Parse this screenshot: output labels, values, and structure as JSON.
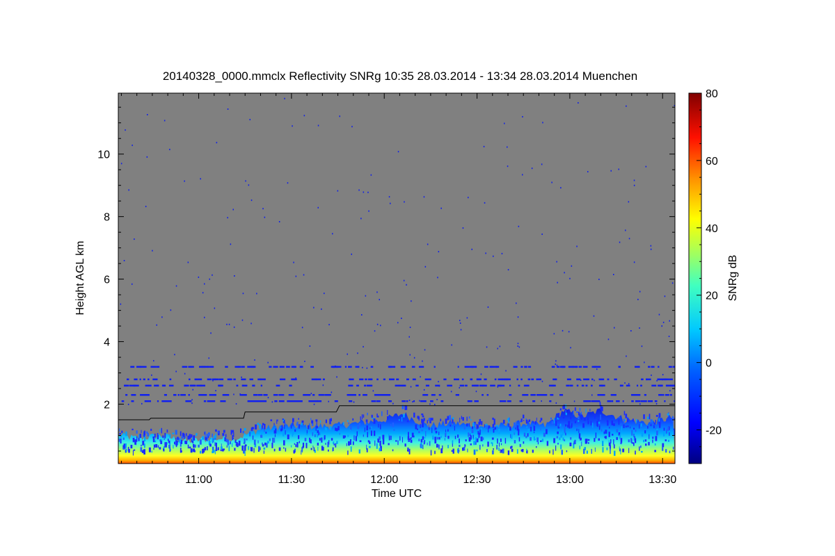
{
  "chart_data": {
    "type": "heatmap",
    "title": "20140328_0000.mmclx Reflectivity SNRg   10:35 28.03.2014 - 13:34 28.03.2014 Muenchen",
    "xlabel": "Time UTC",
    "ylabel": "Height AGL km",
    "colorbar_label": "SNRg dB",
    "x_range_minutes": [
      634,
      814
    ],
    "x_ticks": [
      {
        "min": 660,
        "label": "11:00"
      },
      {
        "min": 690,
        "label": "11:30"
      },
      {
        "min": 720,
        "label": "12:00"
      },
      {
        "min": 750,
        "label": "12:30"
      },
      {
        "min": 780,
        "label": "13:00"
      },
      {
        "min": 810,
        "label": "13:30"
      }
    ],
    "ylim": [
      0.1,
      11.95
    ],
    "y_ticks": [
      2,
      4,
      6,
      8,
      10
    ],
    "colorbar_range": [
      -30,
      80
    ],
    "colorbar_ticks": [
      -20,
      0,
      20,
      40,
      60,
      80
    ],
    "background_color": "#808080",
    "boundary_line": [
      {
        "t": 634,
        "h": 1.5
      },
      {
        "t": 644,
        "h": 1.5
      },
      {
        "t": 644.5,
        "h": 1.55
      },
      {
        "t": 674.5,
        "h": 1.55
      },
      {
        "t": 675,
        "h": 1.75
      },
      {
        "t": 704.5,
        "h": 1.75
      },
      {
        "t": 705.5,
        "h": 1.95
      },
      {
        "t": 814,
        "h": 1.95
      }
    ],
    "echo_layer_top_km": [
      {
        "t": 634,
        "h": 1.0
      },
      {
        "t": 640,
        "h": 0.9
      },
      {
        "t": 648,
        "h": 1.0
      },
      {
        "t": 656,
        "h": 0.8
      },
      {
        "t": 664,
        "h": 0.9
      },
      {
        "t": 672,
        "h": 0.9
      },
      {
        "t": 680,
        "h": 1.2
      },
      {
        "t": 688,
        "h": 1.3
      },
      {
        "t": 696,
        "h": 1.3
      },
      {
        "t": 704,
        "h": 1.3
      },
      {
        "t": 712,
        "h": 1.4
      },
      {
        "t": 720,
        "h": 1.5
      },
      {
        "t": 726,
        "h": 1.7
      },
      {
        "t": 734,
        "h": 1.3
      },
      {
        "t": 742,
        "h": 1.4
      },
      {
        "t": 750,
        "h": 1.3
      },
      {
        "t": 758,
        "h": 1.3
      },
      {
        "t": 766,
        "h": 1.4
      },
      {
        "t": 772,
        "h": 1.3
      },
      {
        "t": 778,
        "h": 1.8
      },
      {
        "t": 784,
        "h": 1.6
      },
      {
        "t": 790,
        "h": 1.8
      },
      {
        "t": 798,
        "h": 1.5
      },
      {
        "t": 806,
        "h": 1.4
      },
      {
        "t": 814,
        "h": 1.6
      }
    ],
    "sparse_bands_km": [
      2.1,
      2.3,
      2.6,
      2.8,
      3.2
    ]
  }
}
